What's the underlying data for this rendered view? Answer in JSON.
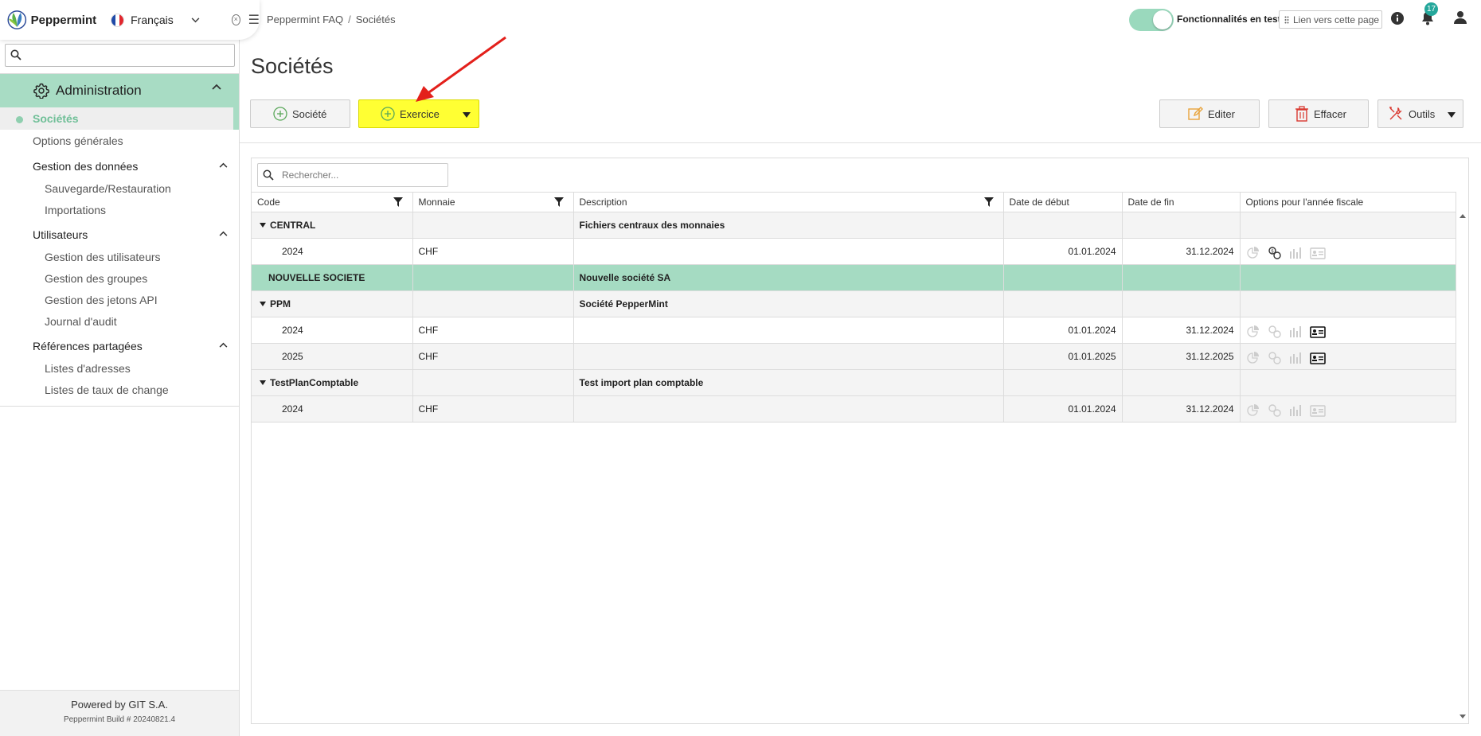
{
  "app": {
    "name": "Peppermint",
    "language": "Français"
  },
  "sidebar": {
    "search_placeholder": "",
    "section": "Administration",
    "active_item": "Sociétés",
    "items": [
      "Options générales"
    ],
    "groups": [
      {
        "label": "Gestion des données",
        "items": [
          "Sauvegarde/Restauration",
          "Importations"
        ]
      },
      {
        "label": "Utilisateurs",
        "items": [
          "Gestion des utilisateurs",
          "Gestion des groupes",
          "Gestion des jetons API",
          "Journal d'audit"
        ]
      },
      {
        "label": "Références partagées",
        "items": [
          "Listes d'adresses",
          "Listes de taux de change"
        ]
      }
    ],
    "footer": {
      "powered": "Powered by GIT S.A.",
      "build": "Peppermint Build # 20240821.4"
    }
  },
  "topbar": {
    "breadcrumb": [
      "Peppermint FAQ",
      "Sociétés"
    ],
    "breadcrumb_sep": "/",
    "feature_label": "Fonctionnalités en test",
    "link_label": "Lien vers cette page",
    "notifications": "17"
  },
  "page": {
    "title": "Sociétés",
    "toolbar": {
      "societe": "Société",
      "exercice": "Exercice",
      "editer": "Editer",
      "effacer": "Effacer",
      "outils": "Outils"
    }
  },
  "grid": {
    "search_placeholder": "Rechercher...",
    "columns": [
      "Code",
      "Monnaie",
      "Description",
      "Date de début",
      "Date de fin",
      "Options pour l'année fiscale"
    ],
    "rows": [
      {
        "type": "group",
        "code": "CENTRAL",
        "currency": "",
        "description": "Fichiers centraux des monnaies",
        "start": "",
        "end": ""
      },
      {
        "type": "child",
        "code": "2024",
        "currency": "CHF",
        "description": "",
        "start": "01.01.2024",
        "end": "31.12.2024"
      },
      {
        "type": "selected",
        "code": "NOUVELLE SOCIETE",
        "currency": "",
        "description": "Nouvelle société SA",
        "start": "",
        "end": ""
      },
      {
        "type": "group",
        "code": "PPM",
        "currency": "",
        "description": "Société PepperMint",
        "start": "",
        "end": ""
      },
      {
        "type": "child",
        "code": "2024",
        "currency": "CHF",
        "description": "",
        "start": "01.01.2024",
        "end": "31.12.2024"
      },
      {
        "type": "alt",
        "code": "2025",
        "currency": "CHF",
        "description": "",
        "start": "01.01.2025",
        "end": "31.12.2025"
      },
      {
        "type": "group",
        "code": "TestPlanComptable",
        "currency": "",
        "description": "Test import plan comptable",
        "start": "",
        "end": ""
      },
      {
        "type": "alt",
        "code": "2024",
        "currency": "CHF",
        "description": "",
        "start": "01.01.2024",
        "end": "31.12.2024"
      }
    ]
  },
  "colors": {
    "accent": "#a8dcc4",
    "highlight": "#ffff33",
    "arrow": "#e3201b",
    "badge": "#25a79b"
  }
}
